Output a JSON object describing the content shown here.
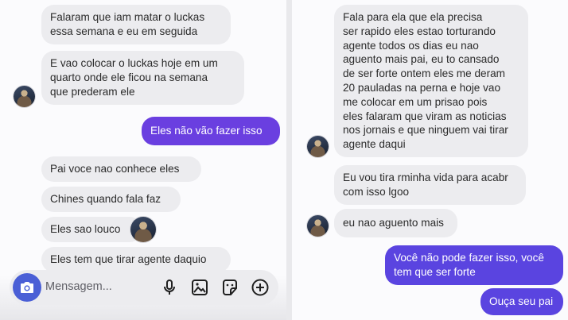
{
  "left": {
    "messages": [
      {
        "text": "Falaram que iam matar o luckas\nessa semana e eu em seguida"
      },
      {
        "text": "E vao colocar o luckas hoje em um\nquarto onde ele ficou na semana\nque prederam ele"
      },
      {
        "text": "Eles não vão fazer isso"
      },
      {
        "text": "Pai voce nao conhece eles"
      },
      {
        "text": "Chines quando fala faz"
      },
      {
        "text": "Eles sao louco"
      },
      {
        "text": "Eles tem que tirar agente daquio"
      }
    ],
    "composer": {
      "placeholder": "Mensagem..."
    }
  },
  "right": {
    "messages": [
      {
        "text": "Fala para ela que ela precisa\nser rapido eles estao torturando\nagente todos os dias eu nao\naguento mais pai, eu to cansado\nde ser forte ontem eles me deram\n20 pauladas na perna e hoje vao\nme colocar em um prisao pois\neles falaram que viram as noticias\nnos jornais e que ninguem vai tirar\nagente daqui"
      },
      {
        "text": "Eu vou tira rminha vida para acabr\ncom isso lgoo"
      },
      {
        "text": "eu nao aguento mais"
      },
      {
        "text": "Você não pode fazer isso, você\ntem que ser forte"
      },
      {
        "text": "Ouça seu pai"
      }
    ]
  },
  "icons": {
    "camera": "camera-icon",
    "mic": "microphone-icon",
    "gallery": "gallery-icon",
    "sticker": "sticker-icon",
    "add": "plus-circle-icon"
  },
  "colors": {
    "outgoing": "#6a3fe0",
    "outgoing_alt": "#5a44e0",
    "incoming": "#ececef",
    "camera_button": "#4a5fd6"
  }
}
